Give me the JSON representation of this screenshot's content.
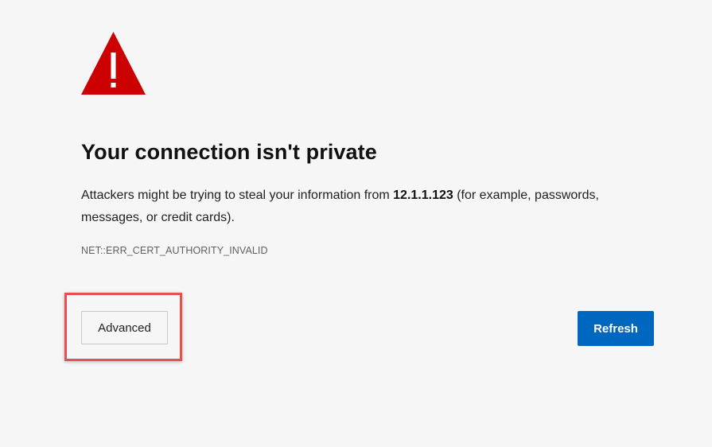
{
  "page": {
    "title": "Your connection isn't private",
    "message": {
      "before": "Attackers might be trying to steal your information from ",
      "host": "12.1.1.123",
      "after": " (for example, passwords, messages, or credit cards)."
    },
    "error_code": "NET::ERR_CERT_AUTHORITY_INVALID"
  },
  "buttons": {
    "advanced_label": "Advanced",
    "refresh_label": "Refresh"
  },
  "colors": {
    "warning_icon": "#cc0000",
    "refresh_button": "#0067c0",
    "highlight_box": "#e8504f",
    "background": "#f6f6f6"
  },
  "icons": {
    "warning": "warning-triangle-icon"
  }
}
